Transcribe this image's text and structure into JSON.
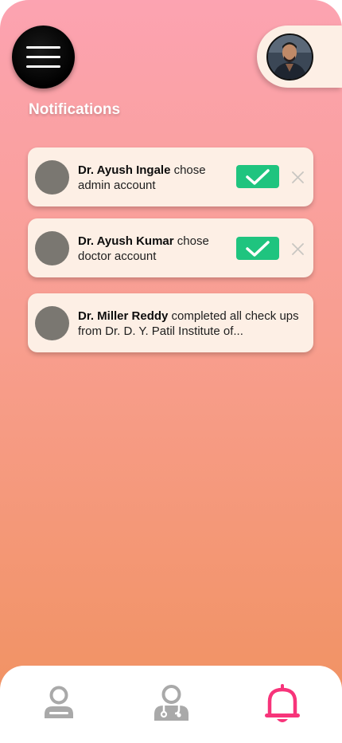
{
  "header": {
    "menu_icon": "hamburger-menu-icon",
    "profile_avatar": "user-profile-photo"
  },
  "page": {
    "title": "Notifications"
  },
  "notifications": [
    {
      "name": "Dr. Ayush Ingale",
      "message": " chose admin account",
      "actions": true,
      "accept_icon": "check-icon",
      "reject_icon": "close-icon"
    },
    {
      "name": "Dr. Ayush Kumar",
      "message": " chose doctor account",
      "actions": true,
      "accept_icon": "check-icon",
      "reject_icon": "close-icon"
    },
    {
      "name": "Dr. Miller Reddy",
      "message": " completed all check ups from Dr. D. Y. Patil Institute of...",
      "actions": false
    }
  ],
  "bottom_nav": {
    "items": [
      {
        "icon": "person-icon",
        "active": false
      },
      {
        "icon": "doctor-icon",
        "active": false
      },
      {
        "icon": "bell-icon",
        "active": true
      }
    ]
  },
  "colors": {
    "gradient_top": "#fca3b1",
    "gradient_bottom": "#f0915e",
    "card_bg": "#fdefe5",
    "accept_green": "#1fc47f",
    "active_pink": "#f7347a",
    "inactive_gray": "#a9a9a9"
  }
}
